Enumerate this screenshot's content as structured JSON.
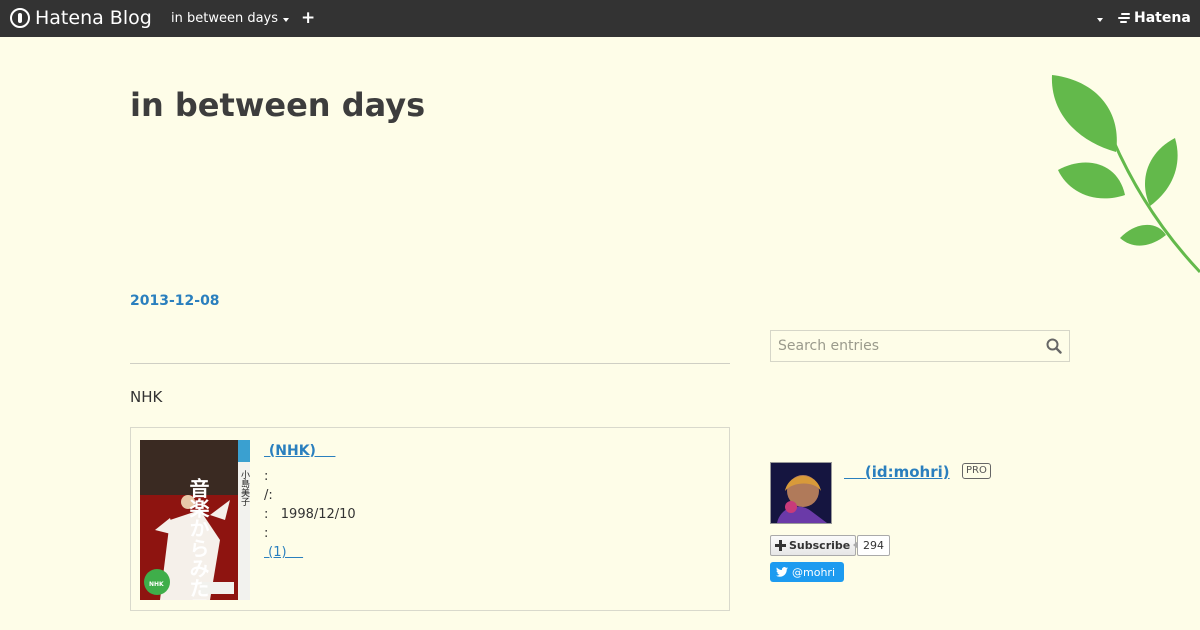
{
  "topbar": {
    "logo_text": "Hatena Blog",
    "blog_menu_label": "in between days",
    "plus_label": "+",
    "hatena_label": "Hatena"
  },
  "blog": {
    "title": "in between days",
    "date": "2013-12-08",
    "entry_text": "NHK"
  },
  "product": {
    "title": " (NHK)    ",
    "line1": ":",
    "line2": "/:",
    "line3": ":   1998/12/10",
    "line4": ":",
    "link": " (1)    ",
    "cover_title": "音楽からみた日本人",
    "cover_author": "小島美子",
    "cover_series": "NHK"
  },
  "sidebar": {
    "search_placeholder": "Search entries",
    "profile_name": "    (id:mohri)",
    "pro_badge": "PRO",
    "subscribe_label": "Subscribe",
    "subscriber_count": "294",
    "twitter_handle": "@mohri"
  },
  "colors": {
    "page_background": "#fefde8",
    "topbar_background": "#333333",
    "link": "#2a7fbe",
    "leaf": "#63b94b",
    "twitter": "#1d9bf0"
  }
}
